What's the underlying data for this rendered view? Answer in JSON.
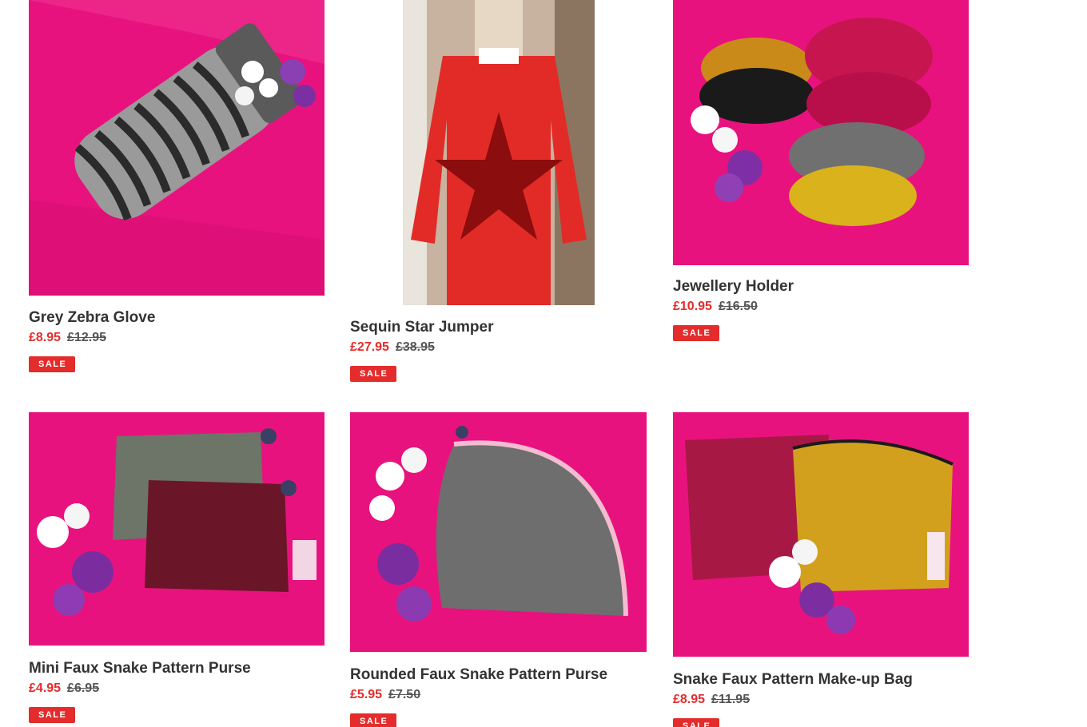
{
  "products": [
    {
      "title": "Grey Zebra Glove",
      "price": "£8.95",
      "compare_price": "£12.95",
      "badge": "SALE"
    },
    {
      "title": "Sequin Star Jumper",
      "price": "£27.95",
      "compare_price": "£38.95",
      "badge": "SALE"
    },
    {
      "title": "Jewellery Holder",
      "price": "£10.95",
      "compare_price": "£16.50",
      "badge": "SALE"
    },
    {
      "title": "Mini Faux Snake Pattern Purse",
      "price": "£4.95",
      "compare_price": "£6.95",
      "badge": "SALE"
    },
    {
      "title": "Rounded Faux Snake Pattern Purse",
      "price": "£5.95",
      "compare_price": "£7.50",
      "badge": "SALE"
    },
    {
      "title": "Snake Faux Pattern Make-up Bag",
      "price": "£8.95",
      "compare_price": "£11.95",
      "badge": "SALE"
    }
  ],
  "colors": {
    "sale_red": "#e32c2b",
    "tissue_pink": "#e8127e",
    "text_dark": "#333333"
  }
}
